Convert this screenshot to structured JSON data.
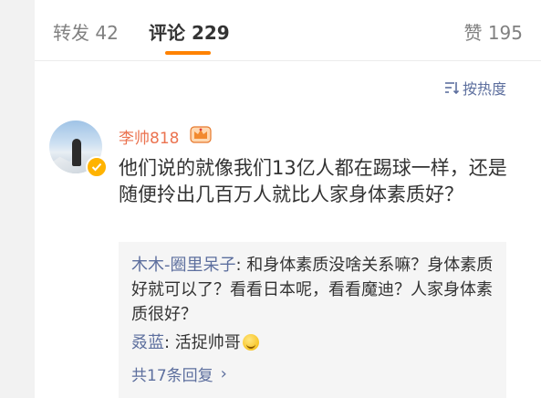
{
  "tabs": {
    "repost": {
      "label": "转发",
      "count": "42"
    },
    "comment": {
      "label": "评论",
      "count": "229"
    },
    "like": {
      "label": "赞",
      "count": "195"
    }
  },
  "sort": {
    "label": "按热度",
    "icon": "sort-icon"
  },
  "comment": {
    "username": "李帅818",
    "text": "他们说的就像我们13亿人都在踢球一样，还是随便拎出几百万人就比人家身体素质好？",
    "avatar_icon": "avatar",
    "badge_icon": "verified-icon",
    "crown_icon": "crown-icon"
  },
  "replies": [
    {
      "name": "木木-圈里呆子",
      "text": ": 和身体素质没啥关系嘛？身体素质好就可以了？看看日本呢，看看魔迪？人家身体素质很好？"
    },
    {
      "name": "叒蓝",
      "text": ": 活捉帅哥",
      "emoji": "smile-emoji"
    }
  ],
  "more_replies": "共17条回复",
  "colors": {
    "accent": "#ff8200",
    "username": "#eb7350",
    "link": "#5d6f9e"
  }
}
